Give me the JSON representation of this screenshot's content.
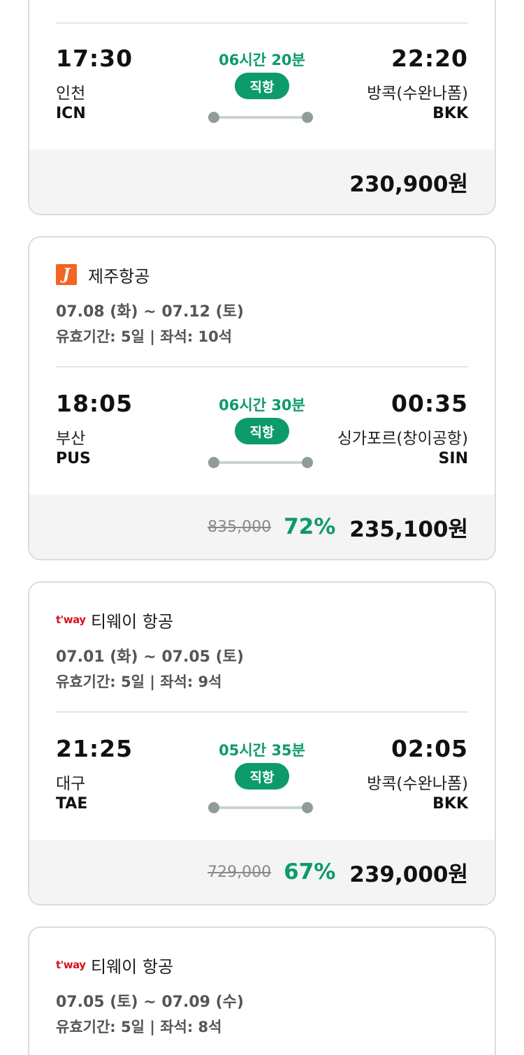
{
  "cards": [
    {
      "flight": {
        "dep_time": "17:30",
        "dep_city": "인천",
        "dep_code": "ICN",
        "arr_time": "22:20",
        "arr_city": "방콕(수완나폼)",
        "arr_code": "BKK",
        "duration": "06시간 20분",
        "type": "직항"
      },
      "price": {
        "final": "230,900원"
      }
    },
    {
      "airline": {
        "name": "제주항공",
        "logo_letter": "J",
        "logo_color": "#f26522"
      },
      "dates": "07.08 (화) ~ 07.12 (토)",
      "meta": "유효기간: 5일 | 좌석: 10석",
      "flight": {
        "dep_time": "18:05",
        "dep_city": "부산",
        "dep_code": "PUS",
        "arr_time": "00:35",
        "arr_city": "싱가포르(창이공항)",
        "arr_code": "SIN",
        "duration": "06시간 30분",
        "type": "직항"
      },
      "price": {
        "original": "835,000",
        "discount": "72%",
        "final": "235,100원"
      }
    },
    {
      "airline": {
        "name": "티웨이 항공",
        "logo_text": "t'way",
        "logo_color": "#d7121a"
      },
      "dates": "07.01 (화) ~ 07.05 (토)",
      "meta": "유효기간: 5일 | 좌석: 9석",
      "flight": {
        "dep_time": "21:25",
        "dep_city": "대구",
        "dep_code": "TAE",
        "arr_time": "02:05",
        "arr_city": "방콕(수완나폼)",
        "arr_code": "BKK",
        "duration": "05시간 35분",
        "type": "직항"
      },
      "price": {
        "original": "729,000",
        "discount": "67%",
        "final": "239,000원"
      }
    },
    {
      "airline": {
        "name": "티웨이 항공",
        "logo_text": "t'way",
        "logo_color": "#d7121a"
      },
      "dates": "07.05 (토) ~ 07.09 (수)",
      "meta": "유효기간: 5일 | 좌석: 8석"
    }
  ],
  "colors": {
    "accent": "#0d9a6c",
    "route_line": "#c9d3d1",
    "route_dot": "#8f9c99"
  }
}
